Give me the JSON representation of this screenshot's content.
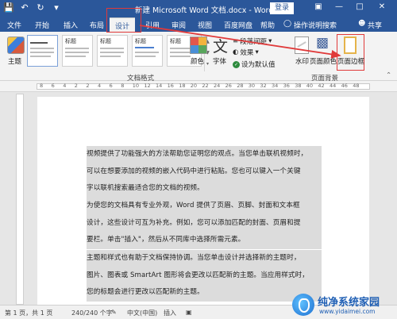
{
  "title_bar": {
    "document_title": "新建 Microsoft Word 文档.docx - Word",
    "login_label": "登录",
    "qat_icons": [
      "save-icon",
      "undo-icon",
      "redo-icon",
      "customize-icon"
    ]
  },
  "tabs": {
    "items": [
      "文件",
      "开始",
      "插入",
      "布局",
      "设计",
      "引用",
      "审阅",
      "视图",
      "百度网盘",
      "帮助"
    ],
    "active": "设计",
    "tell_me": "操作说明搜索",
    "share": "共享"
  },
  "ribbon": {
    "themes_label": "主题",
    "gallery": [
      {
        "title": "",
        "selected": true
      },
      {
        "title": "标题",
        "selected": false
      },
      {
        "title": "标题",
        "selected": false
      },
      {
        "title": "标题",
        "selected": false
      },
      {
        "title": "标题",
        "selected": false
      }
    ],
    "colors_label": "颜色",
    "fonts_label": "字体",
    "paragraph_spacing_label": "段落间距",
    "effects_label": "效果",
    "set_default_label": "设为默认值",
    "format_group_label": "文档格式",
    "watermark_label": "水印",
    "page_color_label": "页面颜色",
    "page_border_label": "页面边框",
    "page_bg_group_label": "页面背景"
  },
  "ruler_numbers": [
    "8",
    "6",
    "4",
    "2",
    "2",
    "4",
    "6",
    "8",
    "10",
    "12",
    "14",
    "16",
    "18",
    "20",
    "22",
    "24",
    "26",
    "28",
    "30",
    "32",
    "34",
    "36",
    "38",
    "40",
    "42",
    "44",
    "46",
    "48"
  ],
  "document": {
    "p1": [
      "视频提供了功能强大的方法帮助您证明您的观点。当您单击联机视频时，",
      "可以在想要添加的视频的嵌入代码中进行粘贴。您也可以键入一个关键",
      "字以联机搜索最适合您的文档的视频。"
    ],
    "p2": [
      "为使您的文档具有专业外观，Word 提供了页眉、页脚、封面和文本框",
      "设计，这些设计可互为补充。例如，您可以添加匹配的封面、页眉和提",
      "要栏。单击\"插入\"，然后从不同库中选择所需元素。"
    ],
    "p3": [
      "主题和样式也有助于文档保持协调。当您单击设计并选择新的主题时，",
      "图片、图表或 SmartArt 图形将会更改以匹配新的主题。当应用样式时，",
      "您的标题会进行更改以匹配新的主题。"
    ]
  },
  "status_bar": {
    "page": "第 1 页，共 1 页",
    "words": "240/240 个字",
    "language": "中文(中国)",
    "mode": "插入"
  },
  "brand": {
    "name": "纯净系统家园",
    "url": "www.yidaimei.com"
  },
  "colors": {
    "accent": "#2b579a",
    "highlight": "#e03a3a",
    "selection": "#dcdcdc"
  }
}
